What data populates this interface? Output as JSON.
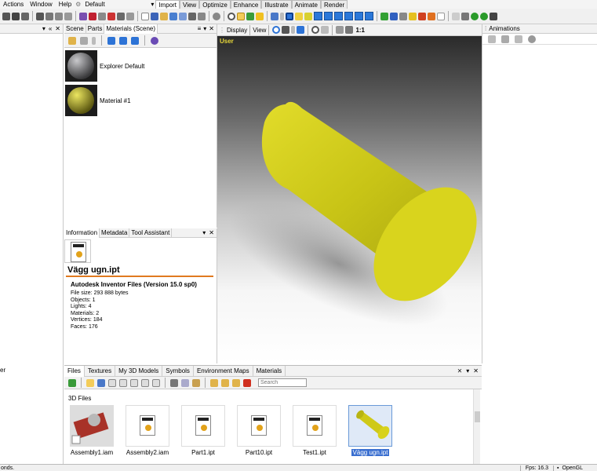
{
  "menu": {
    "items": [
      "Actions",
      "Window",
      "Help"
    ],
    "layout_select": "Default"
  },
  "ribbon_tabs": [
    "Import",
    "View",
    "Optimize",
    "Enhance",
    "Illustrate",
    "Animate",
    "Render"
  ],
  "scene_panel": {
    "tabs": [
      "Scene",
      "Parts",
      "Materials (Scene)"
    ],
    "materials": [
      {
        "name": "Explorer Default",
        "color": "#6d6d70"
      },
      {
        "name": "Material #1",
        "color": "#c9c318"
      }
    ]
  },
  "viewport_toolbar": {
    "display": "Display",
    "view": "View",
    "scale": "1:1"
  },
  "viewport": {
    "camera": "User",
    "object_color": "#d8d41e"
  },
  "info_panel": {
    "tabs": [
      "Information",
      "Metadata",
      "Tool Assistant"
    ],
    "file_title": "Vägg ugn.ipt",
    "file_type": "Autodesk Inventor Files (Version 15.0 sp0)",
    "stats": [
      {
        "label": "File size:",
        "value": "293 888 bytes"
      },
      {
        "label": "Objects:",
        "value": "1"
      },
      {
        "label": "Lights:",
        "value": "4"
      },
      {
        "label": "Materials:",
        "value": "2"
      },
      {
        "label": "Vertices:",
        "value": "184"
      },
      {
        "label": "Faces:",
        "value": "176"
      }
    ]
  },
  "animations_panel": {
    "title": "Animations"
  },
  "library": {
    "tabs": [
      "Files",
      "Textures",
      "My 3D Models",
      "Symbols",
      "Environment Maps",
      "Materials"
    ],
    "search_placeholder": "Search",
    "section_title": "3D Files",
    "files": [
      "Assembly1.iam",
      "Assembly2.iam",
      "Part1.ipt",
      "Part10.ipt",
      "Test1.ipt",
      "Vägg ugn.ipt"
    ]
  },
  "status": {
    "left": "onds.",
    "fps": "Fps: 16.3",
    "renderer": "OpenGL"
  },
  "left_panel": {
    "partial_text": "er"
  }
}
